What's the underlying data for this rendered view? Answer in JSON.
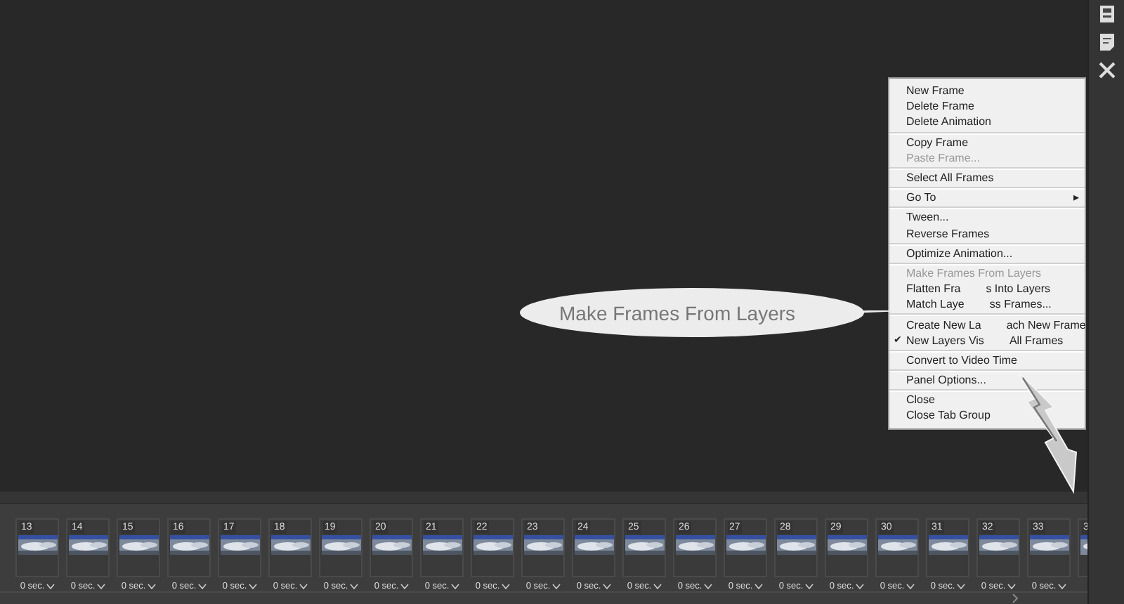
{
  "callout": {
    "text": "Make Frames From Layers"
  },
  "menu": {
    "groups": [
      [
        {
          "text": "New Frame",
          "disabled": false
        },
        {
          "text": "Delete Frame",
          "disabled": false
        },
        {
          "text": "Delete Animation",
          "disabled": false
        }
      ],
      [
        {
          "text": "Copy Frame",
          "disabled": false
        },
        {
          "text": "Paste Frame...",
          "disabled": true
        }
      ],
      [
        {
          "text": "Select All Frames",
          "disabled": false
        }
      ],
      [
        {
          "text": "Go To",
          "disabled": false,
          "submenu": "▸"
        }
      ],
      [
        {
          "text": "Tween...",
          "disabled": false
        },
        {
          "text": "Reverse Frames",
          "disabled": false
        }
      ],
      [
        {
          "text": "Optimize Animation...",
          "disabled": false
        }
      ],
      [
        {
          "text": "Make Frames From Layers",
          "disabled": true
        },
        {
          "text": "Flatten Fra",
          "rest": "s Into Layers",
          "disabled": false
        },
        {
          "text": "Match Laye",
          "rest": "ss Frames...",
          "disabled": false
        }
      ],
      [
        {
          "text": "Create New La",
          "rest": "ach New Frame",
          "disabled": false
        },
        {
          "text": "New Layers Vis",
          "rest": "All Frames",
          "disabled": false,
          "checked": true,
          "check": "✔"
        }
      ],
      [
        {
          "text": "Convert to Video Time",
          "disabled": false
        }
      ],
      [
        {
          "text": "Panel Options...",
          "disabled": false
        }
      ],
      [
        {
          "text": "Close",
          "disabled": false
        },
        {
          "text": "Close Tab Group",
          "disabled": false
        }
      ]
    ]
  },
  "frames": [
    {
      "number": "13",
      "delay": "0 sec."
    },
    {
      "number": "14",
      "delay": "0 sec."
    },
    {
      "number": "15",
      "delay": "0 sec."
    },
    {
      "number": "16",
      "delay": "0 sec."
    },
    {
      "number": "17",
      "delay": "0 sec."
    },
    {
      "number": "18",
      "delay": "0 sec."
    },
    {
      "number": "19",
      "delay": "0 sec."
    },
    {
      "number": "20",
      "delay": "0 sec."
    },
    {
      "number": "21",
      "delay": "0 sec."
    },
    {
      "number": "22",
      "delay": "0 sec."
    },
    {
      "number": "23",
      "delay": "0 sec."
    },
    {
      "number": "24",
      "delay": "0 sec."
    },
    {
      "number": "25",
      "delay": "0 sec."
    },
    {
      "number": "26",
      "delay": "0 sec."
    },
    {
      "number": "27",
      "delay": "0 sec."
    },
    {
      "number": "28",
      "delay": "0 sec."
    },
    {
      "number": "29",
      "delay": "0 sec."
    },
    {
      "number": "30",
      "delay": "0 sec."
    },
    {
      "number": "31",
      "delay": "0 sec."
    },
    {
      "number": "32",
      "delay": "0 sec."
    },
    {
      "number": "33",
      "delay": "0 sec."
    },
    {
      "number": "3"
    }
  ]
}
